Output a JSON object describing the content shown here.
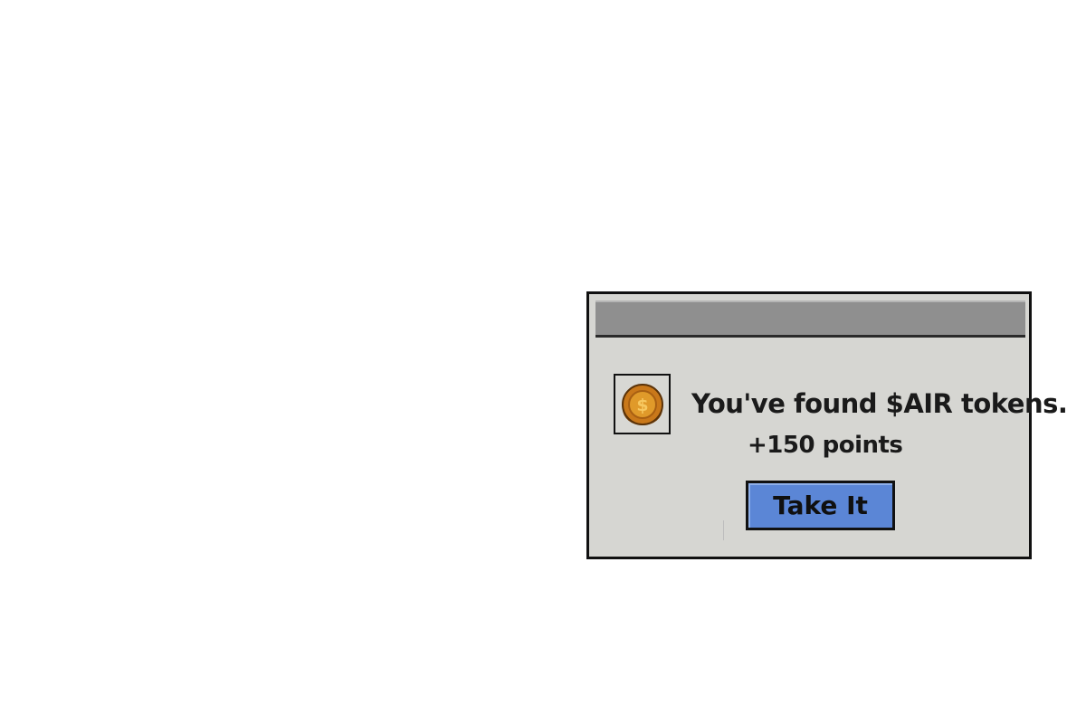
{
  "dialog": {
    "title": "",
    "icon": "coin-icon",
    "icon_symbol": "$",
    "message": "You've found $AIR tokens.",
    "points": "+150 points",
    "button_label": "Take It"
  },
  "colors": {
    "dialog_bg": "#d6d6d2",
    "titlebar": "#8f8f8f",
    "button": "#5b86d6",
    "coin": "#d4891e"
  }
}
